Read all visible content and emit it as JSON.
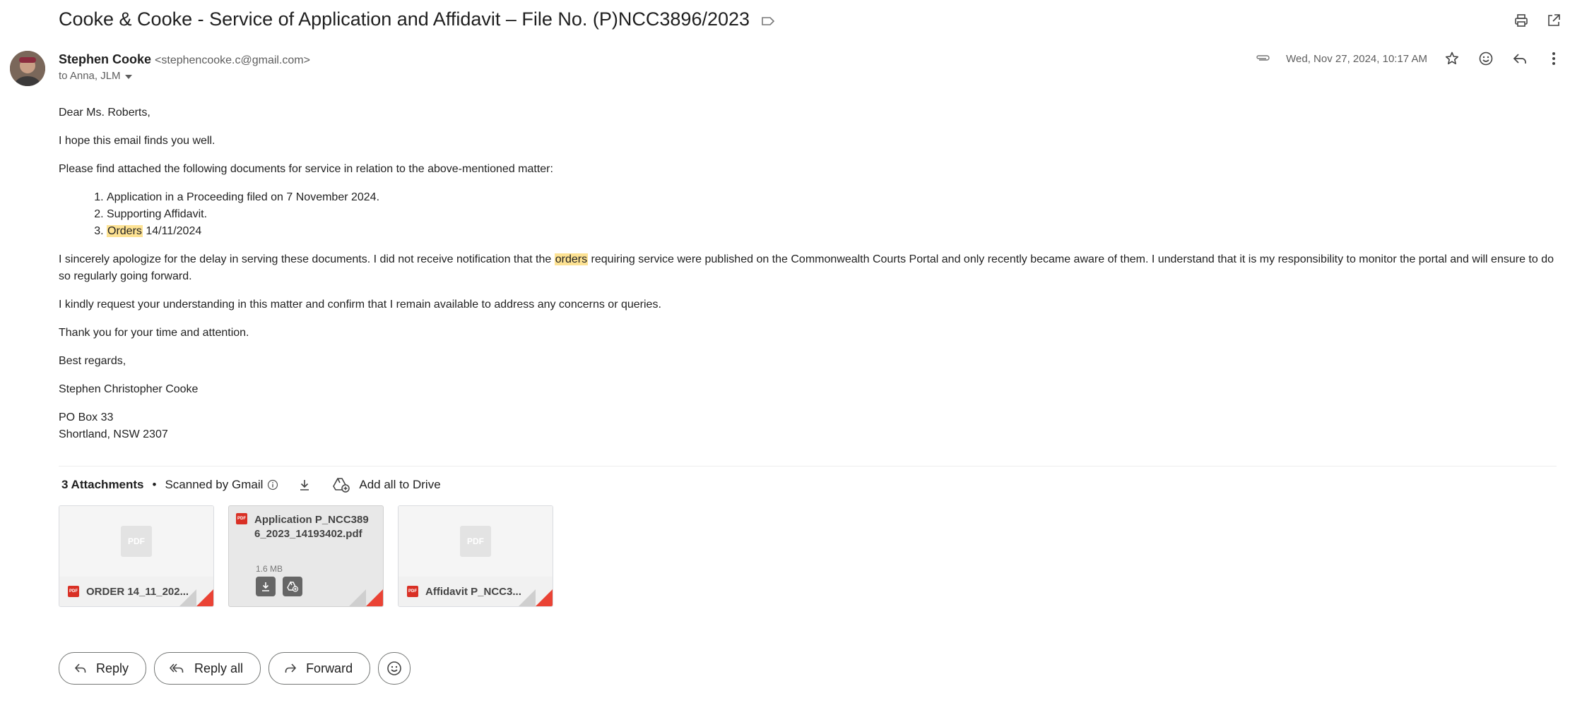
{
  "subject": "Cooke & Cooke - Service of Application and Affidavit – File No. (P)NCC3896/2023",
  "sender": {
    "name": "Stephen Cooke",
    "email": "<stephencooke.c@gmail.com>",
    "to": "to Anna, JLM"
  },
  "meta": {
    "date": "Wed, Nov 27, 2024, 10:17 AM"
  },
  "body": {
    "greeting": "Dear Ms. Roberts,",
    "p1": "I hope this email finds you well.",
    "p2": "Please find attached the following documents for service in relation to the above-mentioned matter:",
    "list": {
      "item1": "Application in a Proceeding filed on 7 November 2024.",
      "item2": "Supporting Affidavit.",
      "item3_highlight": "Orders",
      "item3_rest": " 14/11/2024"
    },
    "p3_start": "I sincerely apologize for the delay in serving these documents. I did not receive notification that the ",
    "p3_highlight": "orders",
    "p3_end": " requiring service were published on the Commonwealth Courts Portal and only recently became aware of them. I understand that it is my responsibility to monitor the portal and will ensure to do so regularly going forward.",
    "p4": "I kindly request your understanding in this matter and confirm that I remain available to address any concerns or queries.",
    "p5": "Thank you for your time and attention.",
    "closing": "Best regards,",
    "signature": "Stephen Christopher Cooke",
    "address1": "PO Box 33",
    "address2": "Shortland, NSW 2307"
  },
  "attachments": {
    "count_label": "3 Attachments",
    "dot": "•",
    "scanned": "Scanned by Gmail",
    "add_drive": "Add all to Drive",
    "items": [
      {
        "name": "ORDER 14_11_202...",
        "thumb": "PDF",
        "badge": "PDF"
      },
      {
        "name": "Application P_NCC3896_2023_14193402.pdf",
        "size": "1.6 MB",
        "badge": "PDF"
      },
      {
        "name": "Affidavit P_NCC3...",
        "thumb": "PDF",
        "badge": "PDF"
      }
    ]
  },
  "actions": {
    "reply": "Reply",
    "reply_all": "Reply all",
    "forward": "Forward"
  }
}
